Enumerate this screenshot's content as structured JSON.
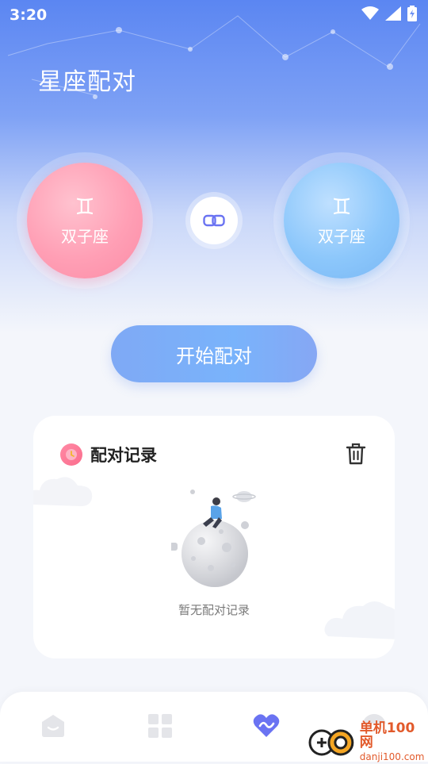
{
  "status_bar": {
    "time": "3:20"
  },
  "page": {
    "title": "星座配对"
  },
  "pair": {
    "left": {
      "glyph": "♊",
      "name": "双子座"
    },
    "right": {
      "glyph": "♊",
      "name": "双子座"
    }
  },
  "actions": {
    "start_label": "开始配对"
  },
  "record_card": {
    "title": "配对记录",
    "empty_text": "暂无配对记录"
  },
  "tabbar": {
    "tabs": [
      "home",
      "apps",
      "match",
      "profile"
    ],
    "active": "match",
    "accent": "#6a73f2"
  },
  "watermark": {
    "cn": "单机100网",
    "en": "danji100.com"
  },
  "colors": {
    "primary": "#5b86f2",
    "pink": "#ff9fb5",
    "blue": "#8cc7fb"
  }
}
